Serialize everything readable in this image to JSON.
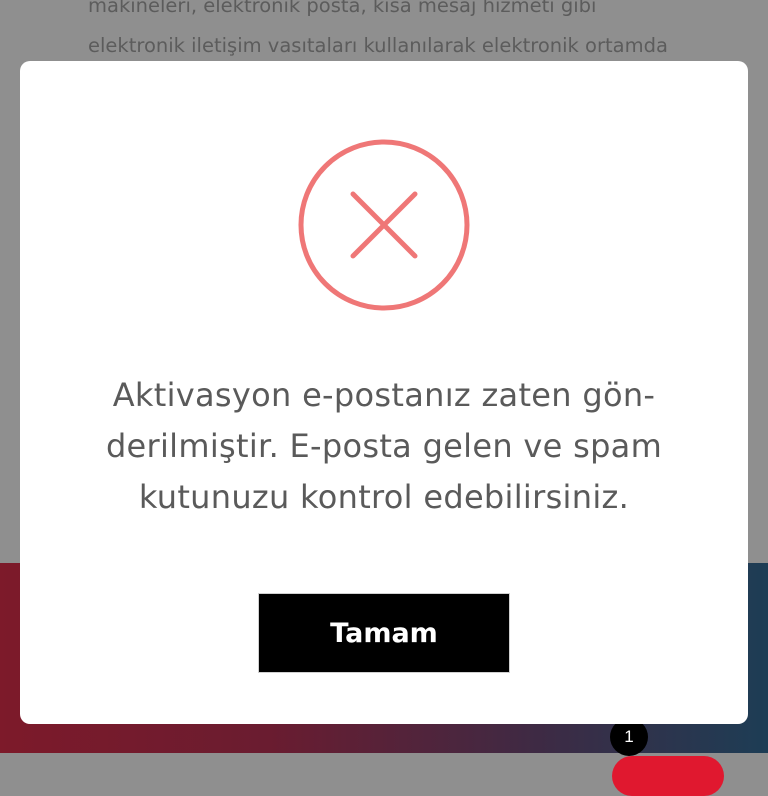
{
  "background": {
    "text_lines": [
      "makineleri, elektronik posta, kısa mesaj hizmeti gibi",
      "elektronik iletişim vasıtaları kullanılarak elektronik ortamda"
    ],
    "notification_count": "1"
  },
  "dialog": {
    "icon": "error-x-circle-icon",
    "message_lines": [
      "Aktivasyon e-postanız zaten gön-",
      "derilmiştir. E-posta gelen ve spam",
      "kutunuzu kontrol edebilirsiniz."
    ],
    "ok_label": "Tamam"
  },
  "colors": {
    "icon_red": "#ef7777",
    "button_bg": "#000000",
    "overlay": "#8f8f8f"
  }
}
